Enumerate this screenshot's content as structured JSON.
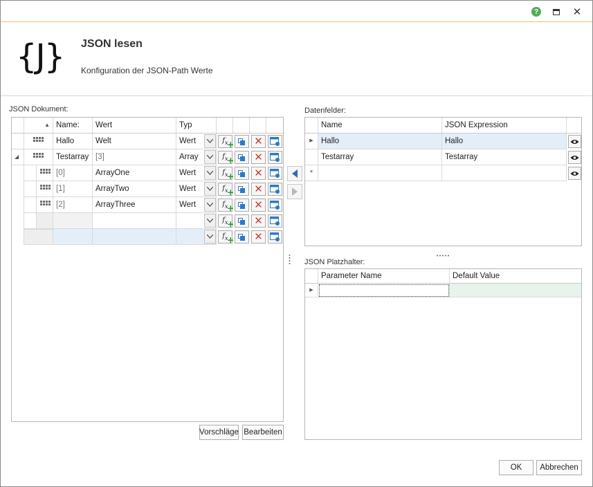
{
  "header": {
    "logo": "{J}",
    "title": "JSON lesen",
    "subtitle": "Konfiguration der JSON-Path Werte"
  },
  "json_document": {
    "label": "JSON Dokument:",
    "columns": [
      "Name:",
      "Wert",
      "Typ"
    ],
    "rows": [
      {
        "name": "Hallo",
        "value": "Welt",
        "type": "Wert"
      },
      {
        "name": "Testarray",
        "value": "[3]",
        "type": "Array"
      },
      {
        "name": "[0]",
        "value": "ArrayOne",
        "type": "Wert"
      },
      {
        "name": "[1]",
        "value": "ArrayTwo",
        "type": "Wert"
      },
      {
        "name": "[2]",
        "value": "ArrayThree",
        "type": "Wert"
      },
      {
        "name": "",
        "value": "",
        "type": ""
      },
      {
        "name": "",
        "value": "",
        "type": ""
      }
    ],
    "suggestions_button": "Vorschläge",
    "edit_button": "Bearbeiten"
  },
  "data_fields": {
    "label": "Datenfelder:",
    "columns": [
      "Name",
      "JSON Expression"
    ],
    "rows": [
      {
        "name": "Hallo",
        "expression": "Hallo"
      },
      {
        "name": "Testarray",
        "expression": "Testarray"
      },
      {
        "name": "",
        "expression": ""
      }
    ]
  },
  "placeholders": {
    "label": "JSON Platzhalter:",
    "columns": [
      "Parameter Name",
      "Default Value"
    ],
    "rows": [
      {
        "name": "",
        "default": ""
      }
    ]
  },
  "footer": {
    "ok": "OK",
    "cancel": "Abbrechen"
  },
  "colors": {
    "accent_line": "#e9c46a",
    "selected_row": "#e3eef9",
    "edit_row": "#e6f4ec",
    "help": "#4fae5a"
  }
}
